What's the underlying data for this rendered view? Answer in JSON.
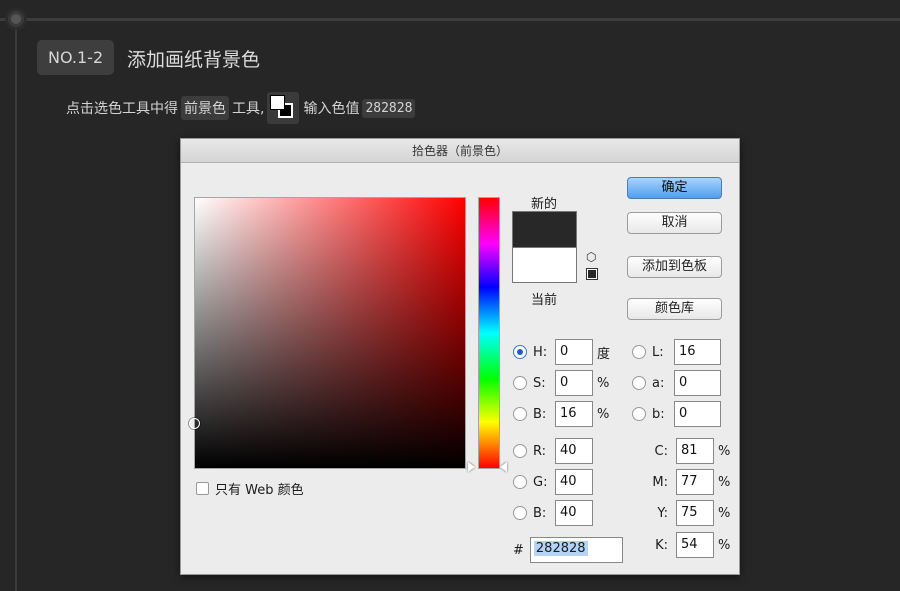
{
  "step": {
    "badge": "NO.1-2",
    "title": "添加画纸背景色"
  },
  "instruction": {
    "part1": "点击选色工具中得",
    "chip_fg": "前景色",
    "part2": "工具,",
    "part3": "输入色值",
    "chip_value": "282828"
  },
  "dialog": {
    "title": "拾色器（前景色）",
    "new_label": "新的",
    "current_label": "当前",
    "new_color": "#282828",
    "current_color": "#ffffff",
    "buttons": {
      "ok": "确定",
      "cancel": "取消",
      "add_swatch": "添加到色板",
      "color_library": "颜色库"
    },
    "web_only": "只有 Web 颜色",
    "hsb": [
      {
        "label": "H:",
        "value": "0",
        "unit": "度",
        "selected": true
      },
      {
        "label": "S:",
        "value": "0",
        "unit": "%",
        "selected": false
      },
      {
        "label": "B:",
        "value": "16",
        "unit": "%",
        "selected": false
      }
    ],
    "rgb": [
      {
        "label": "R:",
        "value": "40"
      },
      {
        "label": "G:",
        "value": "40"
      },
      {
        "label": "B:",
        "value": "40"
      }
    ],
    "lab": [
      {
        "label": "L:",
        "value": "16"
      },
      {
        "label": "a:",
        "value": "0"
      },
      {
        "label": "b:",
        "value": "0"
      }
    ],
    "cmyk": [
      {
        "label": "C:",
        "value": "81",
        "unit": "%"
      },
      {
        "label": "M:",
        "value": "77",
        "unit": "%"
      },
      {
        "label": "Y:",
        "value": "75",
        "unit": "%"
      },
      {
        "label": "K:",
        "value": "54",
        "unit": "%"
      }
    ],
    "hex_label": "#",
    "hex_value": "282828"
  }
}
